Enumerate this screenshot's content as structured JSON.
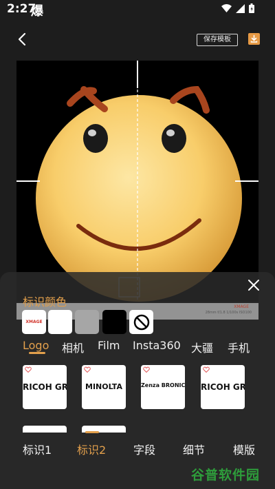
{
  "status_bar": {
    "time": "2:27",
    "carrier_glyph": "爆"
  },
  "top_bar": {
    "save_template_label": "保存模板"
  },
  "watermark_preview": {
    "brand": "XMAGE",
    "details": "28mm f/1.8 1/100s ISO100"
  },
  "color_section": {
    "title": "标识颜色",
    "swatch_xmage_text": "XMAGE"
  },
  "logo_tabs": [
    "Logo",
    "相机",
    "Film",
    "Insta360",
    "大疆",
    "手机"
  ],
  "logo_cards": [
    "RICOH GR II",
    "MINOLTA",
    "Zenza BRONICA",
    "RICOH GR II"
  ],
  "bottom_tabs": [
    "标识1",
    "标识2",
    "字段",
    "细节",
    "模版"
  ],
  "branding": {
    "text": "谷普软件园"
  },
  "colors": {
    "accent": "#e3a04c",
    "panel": "#2a2a2a",
    "brand_green": "#2e9d3b"
  }
}
